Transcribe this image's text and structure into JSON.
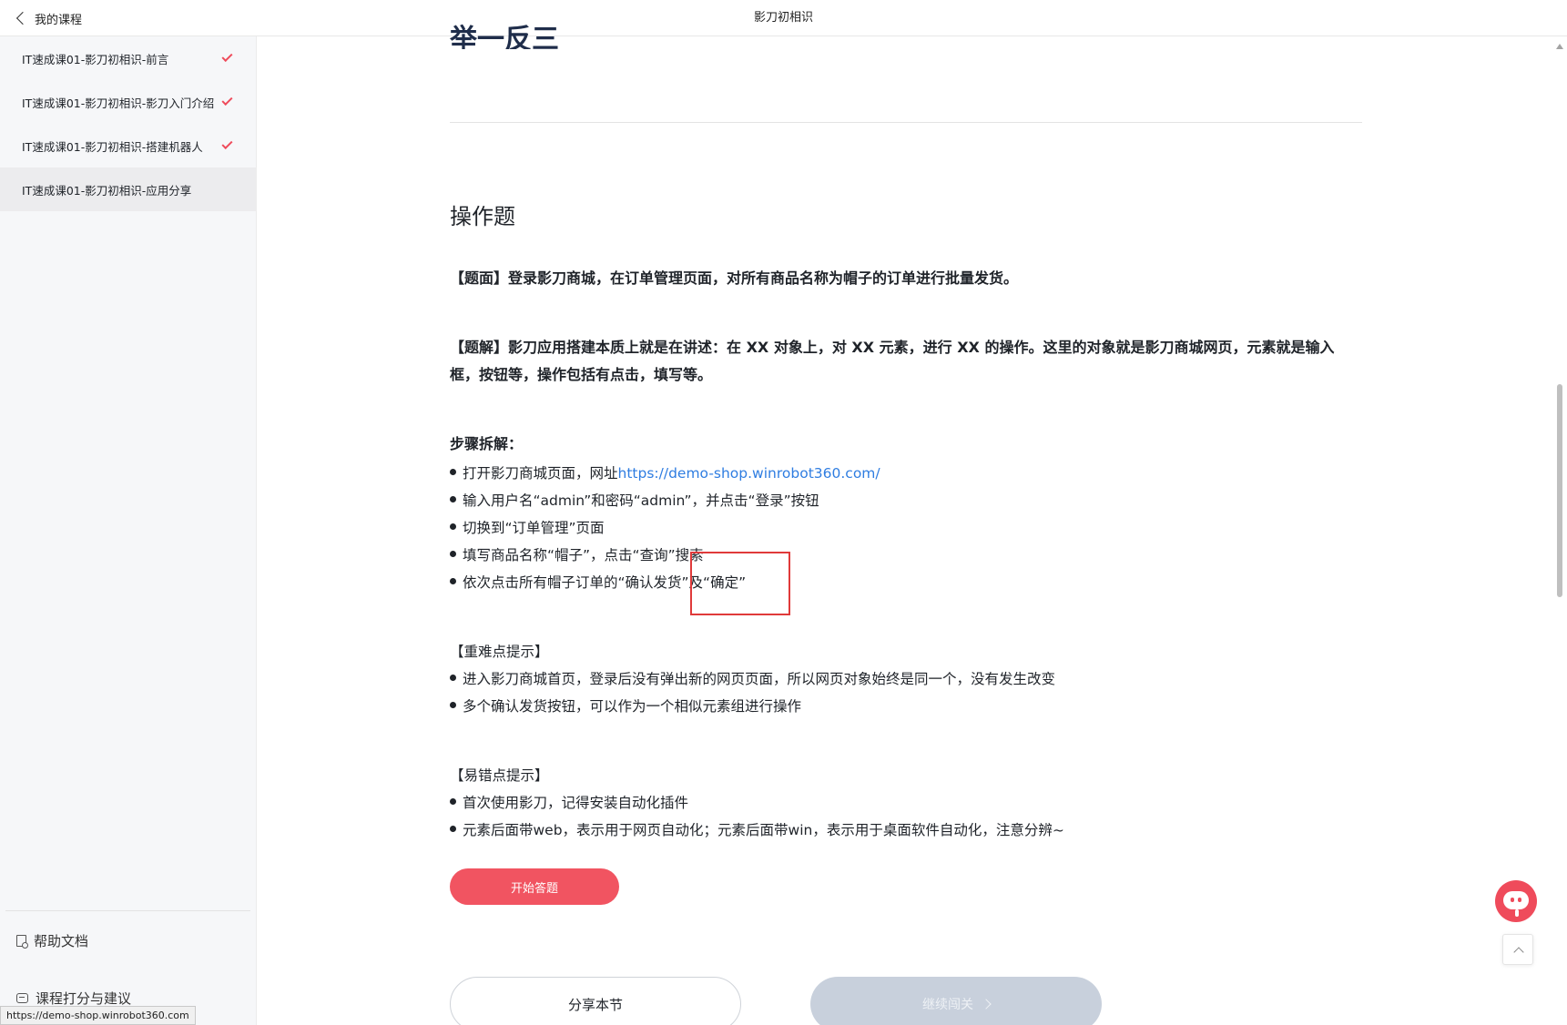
{
  "header": {
    "back_label": "我的课程",
    "title": "影刀初相识"
  },
  "sidebar": {
    "lessons": [
      {
        "label": "IT速成课01-影刀初相识-前言",
        "completed": true
      },
      {
        "label": "IT速成课01-影刀初相识-影刀入门介绍",
        "completed": true
      },
      {
        "label": "IT速成课01-影刀初相识-搭建机器人",
        "completed": true
      },
      {
        "label": "IT速成课01-影刀初相识-应用分享",
        "completed": false,
        "active": true
      }
    ],
    "help_doc": "帮助文档",
    "feedback": "课程打分与建议"
  },
  "status_url": "https://demo-shop.winrobot360.com",
  "main": {
    "clipped_heading": "举一反三",
    "section_title": "操作题",
    "question": "【题面】登录影刀商城，在订单管理页面，对所有商品名称为帽子的订单进行批量发货。",
    "explanation": "【题解】影刀应用搭建本质上就是在讲述：在 XX 对象上，对 XX 元素，进行 XX 的操作。这里的对象就是影刀商城网页，元素就是输入框，按钮等，操作包括有点击，填写等。",
    "steps_title": "步骤拆解：",
    "steps": {
      "s1_prefix": "打开影刀商城页面，网址",
      "s1_link": "https://demo-shop.winrobot360.com/",
      "s2": "输入用户名“admin”和密码“admin”，并点击“登录”按钮",
      "s3": "切换到“订单管理”页面",
      "s4": "填写商品名称“帽子”，点击“查询”搜索",
      "s5": "依次点击所有帽子订单的“确认发货”及“确定”"
    },
    "difficulty_title": "【重难点提示】",
    "difficulty": [
      "进入影刀商城首页，登录后没有弹出新的网页页面，所以网页对象始终是同一个，没有发生改变",
      "多个确认发货按钮，可以作为一个相似元素组进行操作"
    ],
    "mistake_title": "【易错点提示】",
    "mistakes": [
      "首次使用影刀，记得安装自动化插件",
      "元素后面带web，表示用于网页自动化；元素后面带win，表示用于桌面软件自动化，注意分辨~"
    ],
    "start_button": "开始答题",
    "share_button": "分享本节",
    "continue_button": "继续闯关"
  },
  "colors": {
    "accent": "#f15461",
    "check": "#ef4b5b",
    "link": "#2f7de1",
    "highlight_box": "#e03a3a"
  }
}
